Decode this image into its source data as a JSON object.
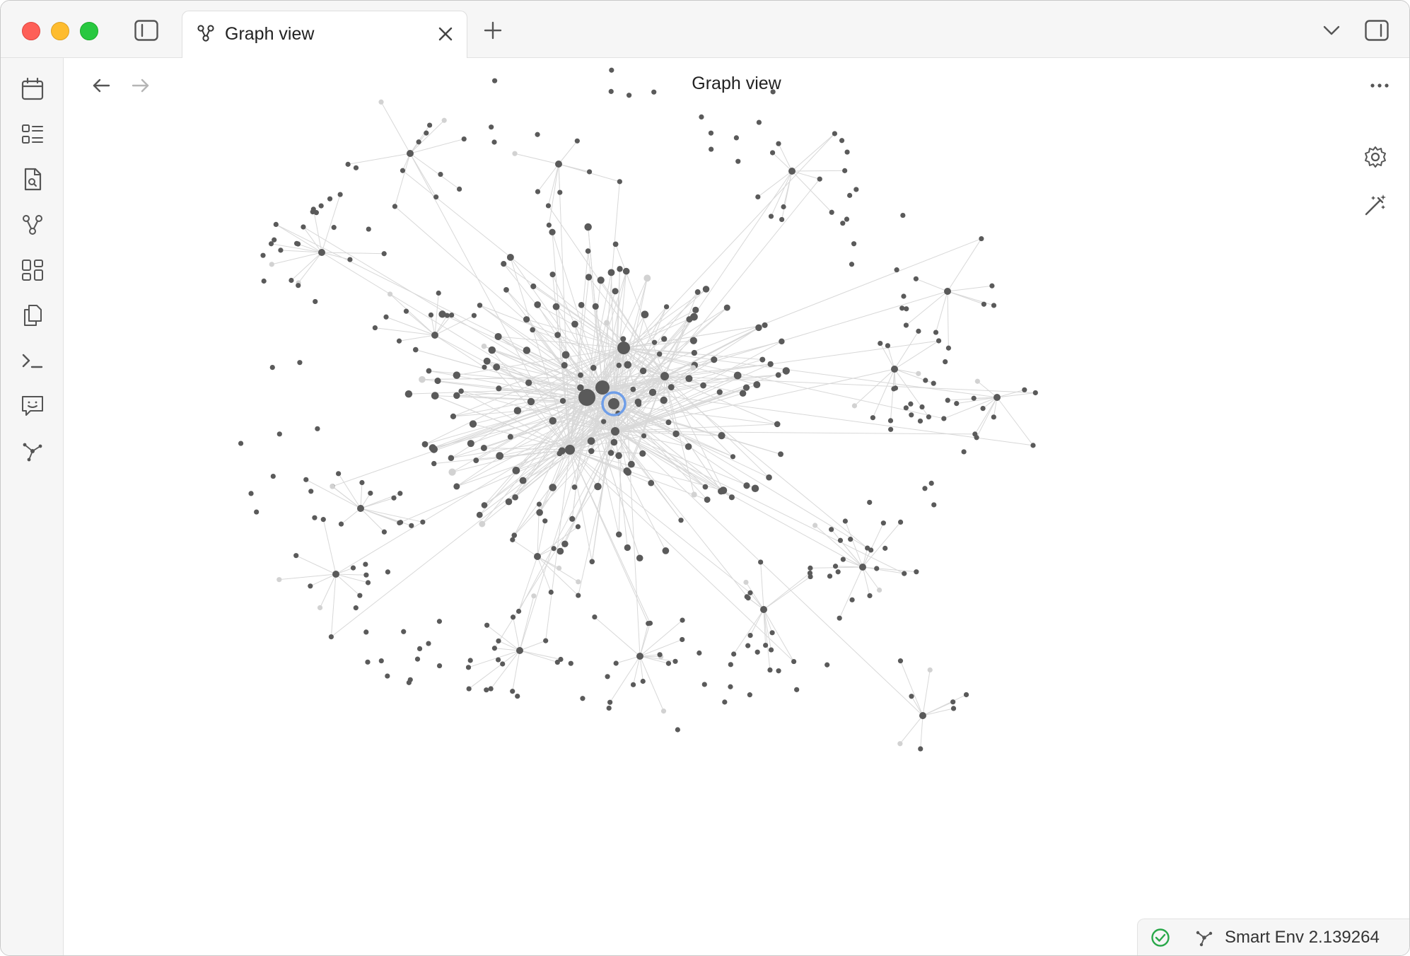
{
  "window": {
    "controls": [
      "close",
      "minimize",
      "zoom"
    ]
  },
  "tabbar": {
    "sidebar_toggle_icon": "sidebar-left-icon",
    "tabs": [
      {
        "title": "Graph view",
        "icon": "graph-icon",
        "active": true
      }
    ],
    "new_tab_icon": "plus-icon",
    "tab_list_icon": "chevron-down-icon",
    "right_sidebar_icon": "sidebar-right-icon"
  },
  "ribbon": {
    "items": [
      {
        "name": "calendar",
        "icon": "calendar-icon"
      },
      {
        "name": "outline",
        "icon": "outline-list-icon"
      },
      {
        "name": "search-file",
        "icon": "file-search-icon"
      },
      {
        "name": "graph",
        "icon": "graph-icon"
      },
      {
        "name": "canvas",
        "icon": "dashboard-icon"
      },
      {
        "name": "files",
        "icon": "copy-files-icon"
      },
      {
        "name": "terminal",
        "icon": "terminal-icon"
      },
      {
        "name": "chat",
        "icon": "chat-icon"
      },
      {
        "name": "smart-connections",
        "icon": "network-icon"
      }
    ]
  },
  "view": {
    "title": "Graph view",
    "back_icon": "arrow-left-icon",
    "forward_icon": "arrow-right-icon",
    "more_icon": "more-horizontal-icon",
    "settings_icon": "gear-icon",
    "animate_icon": "magic-wand-icon"
  },
  "graph": {
    "node_color": "#5a5a5a",
    "faded_node_color": "#d2d2d2",
    "link_color": "#d8d8d8",
    "active_ring_color": "#6f9ee8"
  },
  "statusbar": {
    "sync_icon": "check-circle-icon",
    "sync_color": "#2aa84a",
    "env_icon": "network-icon",
    "env_text": "Smart Env 2.139264"
  }
}
